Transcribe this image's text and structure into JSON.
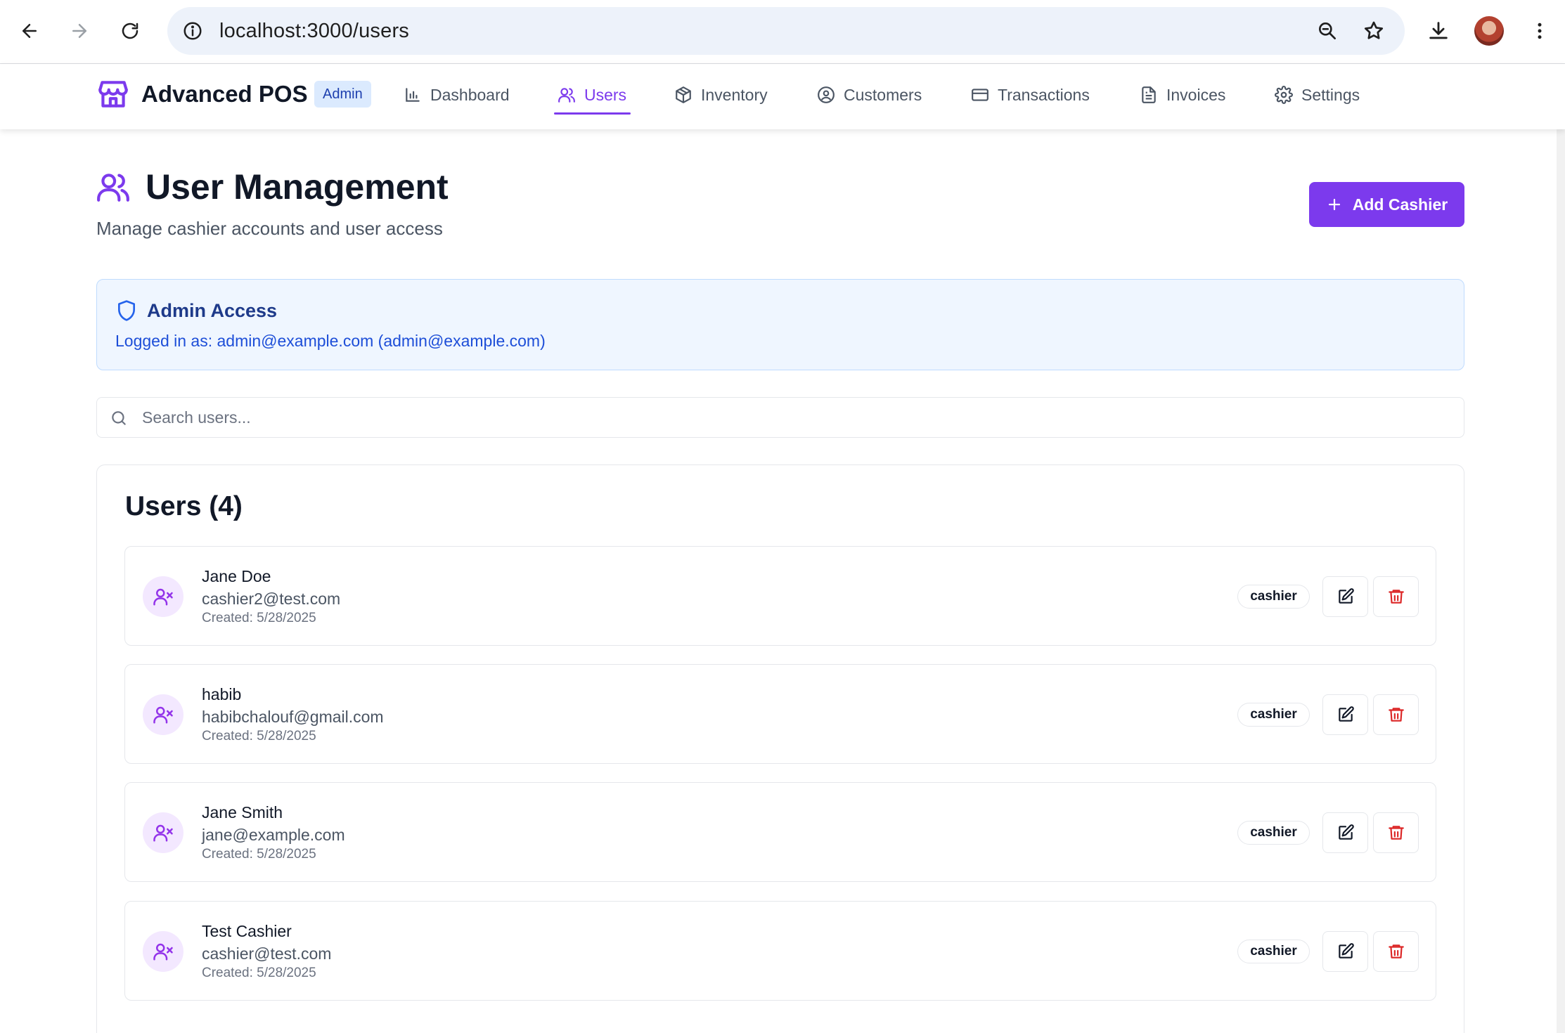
{
  "browser": {
    "url": "localhost:3000/users"
  },
  "app": {
    "brand": "Advanced POS",
    "role_badge": "Admin",
    "nav": [
      {
        "label": "Dashboard",
        "icon": "bar-chart-icon"
      },
      {
        "label": "Users",
        "icon": "users-icon",
        "active": true
      },
      {
        "label": "Inventory",
        "icon": "package-icon"
      },
      {
        "label": "Customers",
        "icon": "user-circle-icon"
      },
      {
        "label": "Transactions",
        "icon": "credit-card-icon"
      },
      {
        "label": "Invoices",
        "icon": "file-text-icon"
      },
      {
        "label": "Settings",
        "icon": "gear-icon"
      }
    ]
  },
  "page": {
    "title": "User Management",
    "subtitle": "Manage cashier accounts and user access",
    "add_button": "Add Cashier"
  },
  "admin_notice": {
    "title": "Admin Access",
    "text": "Logged in as: admin@example.com (admin@example.com)"
  },
  "search": {
    "placeholder": "Search users...",
    "value": ""
  },
  "users": {
    "title": "Users (4)",
    "items": [
      {
        "name": "Jane Doe",
        "email": "cashier2@test.com",
        "created": "Created: 5/28/2025",
        "role": "cashier"
      },
      {
        "name": "habib",
        "email": "habibchalouf@gmail.com",
        "created": "Created: 5/28/2025",
        "role": "cashier"
      },
      {
        "name": "Jane Smith",
        "email": "jane@example.com",
        "created": "Created: 5/28/2025",
        "role": "cashier"
      },
      {
        "name": "Test Cashier",
        "email": "cashier@test.com",
        "created": "Created: 5/28/2025",
        "role": "cashier"
      }
    ]
  },
  "colors": {
    "accent": "#7c3aed",
    "info_bg": "#eff6ff",
    "info_text": "#1d4ed8",
    "danger": "#dc2626"
  }
}
